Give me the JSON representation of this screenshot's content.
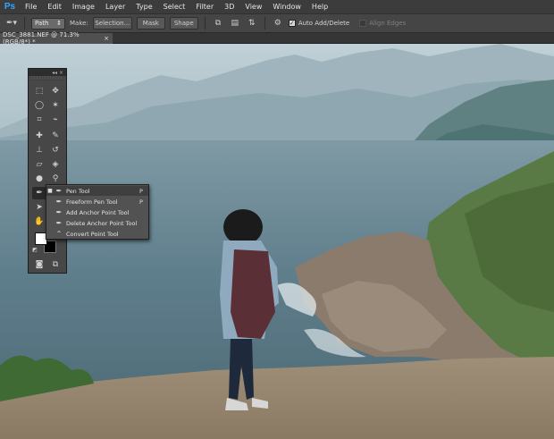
{
  "app": {
    "logo": "Ps",
    "accent": "#31a8ff"
  },
  "menu": [
    "File",
    "Edit",
    "Image",
    "Layer",
    "Type",
    "Select",
    "Filter",
    "3D",
    "View",
    "Window",
    "Help"
  ],
  "options": {
    "mode_value": "Path",
    "make_label": "Make:",
    "selection_label": "Selection...",
    "mask_label": "Mask",
    "shape_label": "Shape",
    "auto_add_delete_label": "Auto Add/Delete",
    "auto_add_delete_checked": true,
    "align_edges_label": "Align Edges",
    "align_edges_checked": false
  },
  "document": {
    "tab_title": "DSC_3881.NEF @ 71.3% (RGB/8*) *",
    "close_symbol": "×"
  },
  "tools_panel": {
    "collapse_symbol": "◂◂ ×"
  },
  "flyout": {
    "items": [
      {
        "label": "Pen Tool",
        "shortcut": "P",
        "selected": true,
        "icon": "pen-icon"
      },
      {
        "label": "Freeform Pen Tool",
        "shortcut": "P",
        "selected": false,
        "icon": "freeform-pen-icon"
      },
      {
        "label": "Add Anchor Point Tool",
        "shortcut": "",
        "selected": false,
        "icon": "add-anchor-icon"
      },
      {
        "label": "Delete Anchor Point Tool",
        "shortcut": "",
        "selected": false,
        "icon": "delete-anchor-icon"
      },
      {
        "label": "Convert Point Tool",
        "shortcut": "",
        "selected": false,
        "icon": "convert-point-icon"
      }
    ]
  },
  "colors": {
    "foreground": "#ffffff",
    "background": "#000000"
  }
}
